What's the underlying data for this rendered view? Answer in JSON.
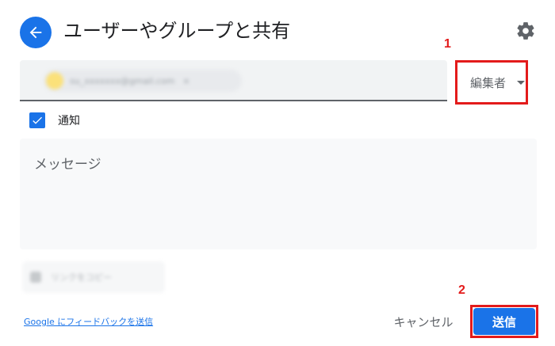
{
  "dialog": {
    "title": "ユーザーやグループと共有",
    "back_icon": "arrow-back-icon",
    "settings_icon": "gear-icon"
  },
  "recipient": {
    "chip_text": "su_xxxxxxx@gmail.com",
    "chip_remove": "×"
  },
  "role": {
    "selected": "編集者"
  },
  "notify": {
    "label": "通知",
    "checked": true
  },
  "message": {
    "placeholder": "メッセージ"
  },
  "extra_option": {
    "label": "リンクをコピー"
  },
  "footer": {
    "feedback_link": "Google にフィードバックを送信",
    "cancel_label": "キャンセル",
    "send_label": "送信"
  },
  "annotations": {
    "step1": "1",
    "step2": "2"
  },
  "colors": {
    "primary": "#1a73e8",
    "annotation": "#e31b1b"
  }
}
